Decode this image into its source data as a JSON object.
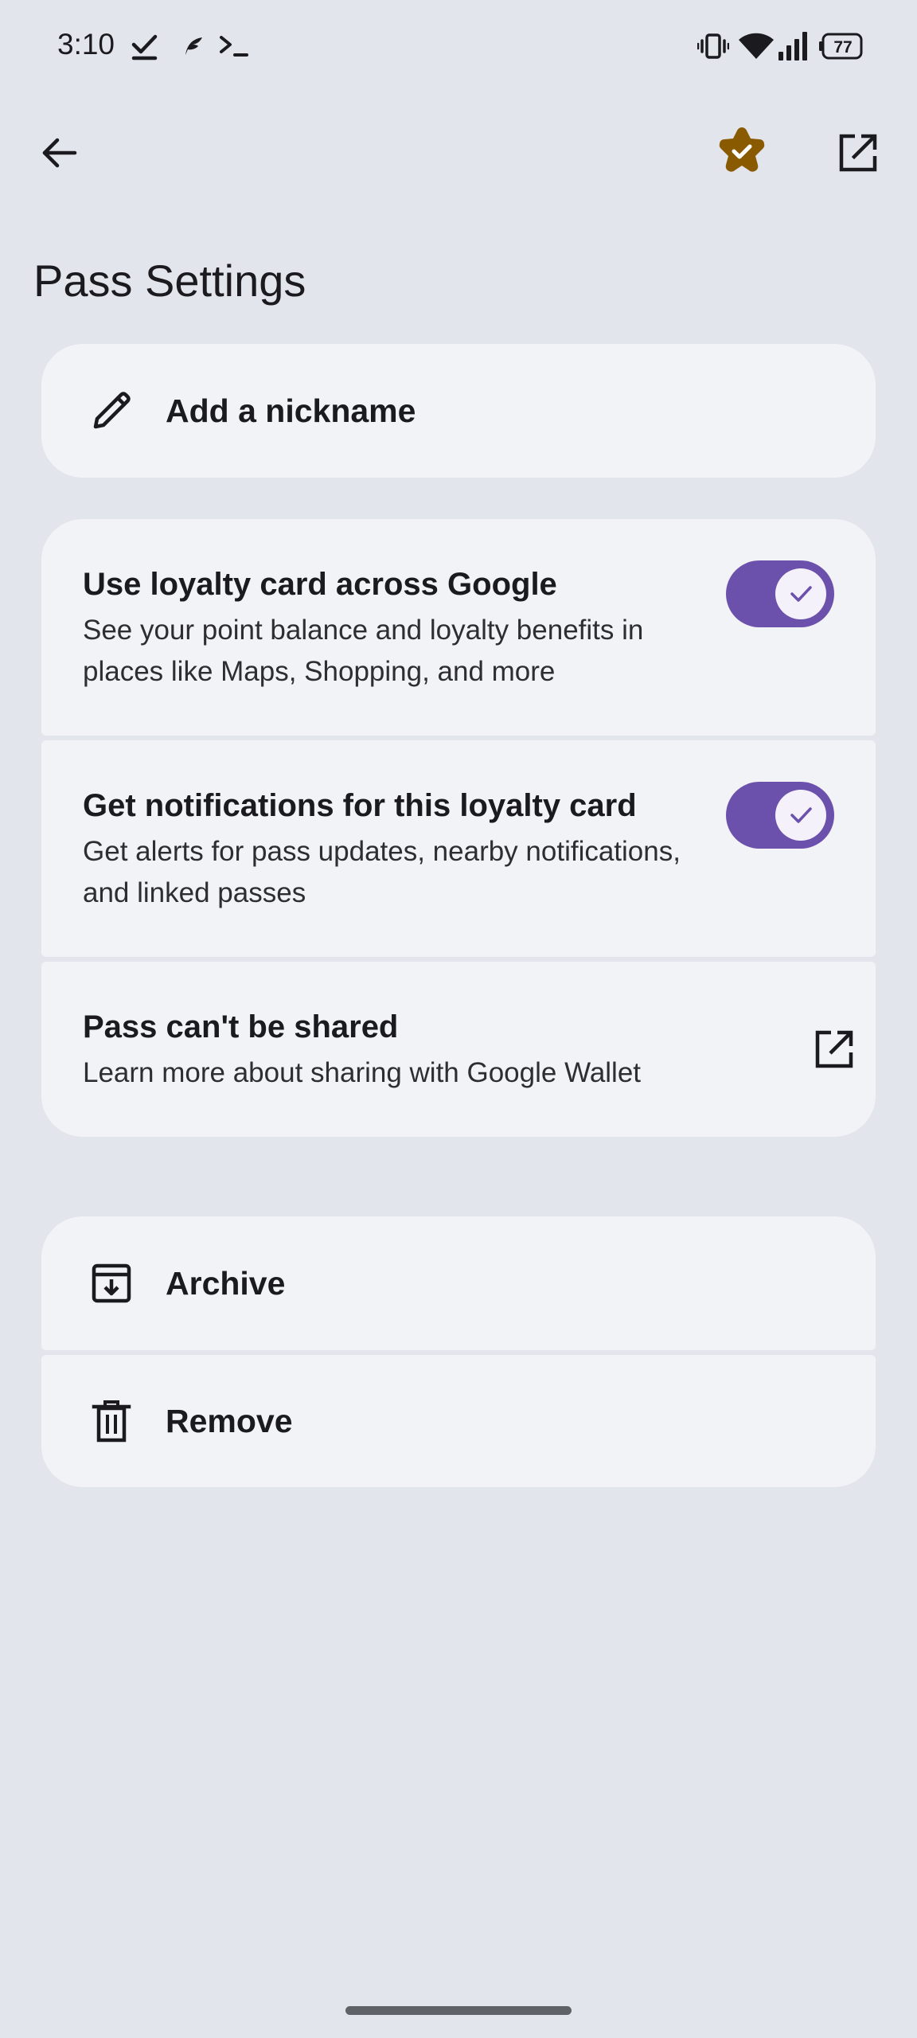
{
  "status_bar": {
    "time": "3:10",
    "battery_level": "77",
    "icons": [
      "checkmark-icon",
      "feather-icon",
      "terminal-icon",
      "vibrate-icon",
      "wifi-icon",
      "signal-icon",
      "battery-icon"
    ]
  },
  "app_bar": {
    "back_icon": "arrow-back-icon",
    "badge_icon": "star-check-icon",
    "open_icon": "open-in-new-icon"
  },
  "page": {
    "title": "Pass Settings"
  },
  "nickname": {
    "label": "Add a nickname",
    "icon": "pencil-icon"
  },
  "settings": {
    "loyalty_across_google": {
      "title": "Use loyalty card across Google",
      "description": "See your point balance and loyalty benefits in places like Maps, Shopping, and more",
      "enabled": true
    },
    "notifications": {
      "title": "Get notifications for this loyalty card",
      "description": "Get alerts for pass updates, nearby notifications, and linked passes",
      "enabled": true
    },
    "sharing": {
      "title": "Pass can't be shared",
      "description": "Learn more about sharing with Google Wallet",
      "icon": "open-in-new-icon"
    }
  },
  "actions": {
    "archive": {
      "label": "Archive",
      "icon": "archive-icon"
    },
    "remove": {
      "label": "Remove",
      "icon": "trash-icon"
    }
  },
  "colors": {
    "background": "#e2e5ec",
    "card": "#f2f3f6",
    "toggle_on": "#6c51ac",
    "badge": "#8a5a00"
  }
}
